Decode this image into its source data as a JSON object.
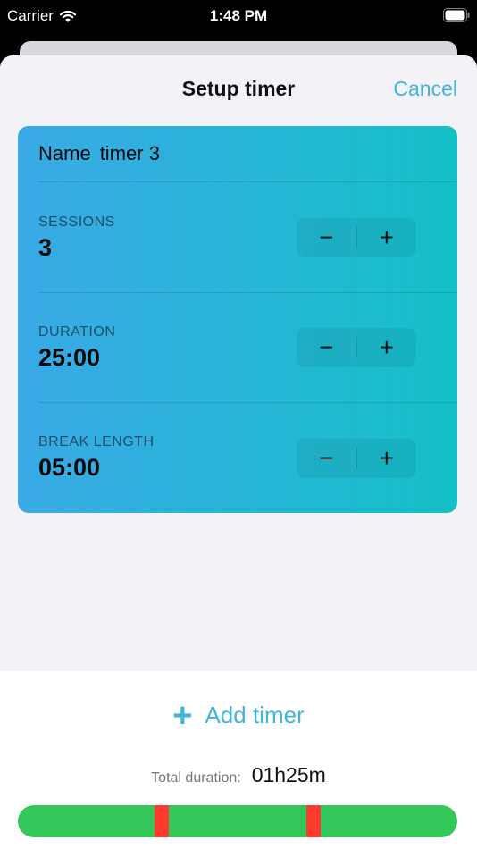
{
  "status_bar": {
    "carrier": "Carrier",
    "time": "1:48 PM",
    "icons": [
      "wifi-icon",
      "battery-icon"
    ]
  },
  "nav": {
    "title": "Setup timer",
    "cancel": "Cancel"
  },
  "timer_card": {
    "name_label": "Name",
    "name_value": "timer 3",
    "rows": [
      {
        "label": "SESSIONS",
        "value": "3"
      },
      {
        "label": "DURATION",
        "value": "25:00"
      },
      {
        "label": "BREAK LENGTH",
        "value": "05:00"
      }
    ],
    "stepper": {
      "minus": "−",
      "plus": "+"
    }
  },
  "footer": {
    "add_icon": "+",
    "add_label": "Add timer",
    "total_label": "Total duration:",
    "total_value": "01h25m",
    "timeline": {
      "session_color": "#34c759",
      "break_color": "#ff3b30",
      "segments": [
        "session",
        "break",
        "session",
        "break",
        "session"
      ]
    }
  },
  "colors": {
    "accent": "#3fb6dc",
    "card_gradient_start": "#3aa9e6",
    "card_gradient_end": "#14c0c8"
  }
}
